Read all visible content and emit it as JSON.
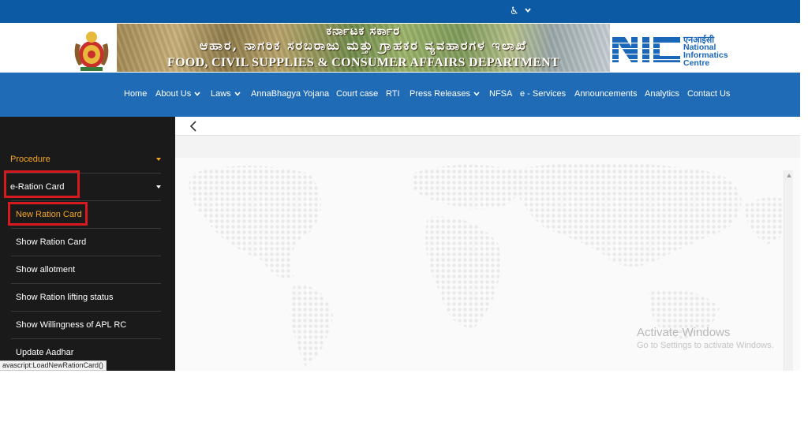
{
  "topbar": {
    "accessibility_symbol": "♿"
  },
  "banner": {
    "kannada_title": "ಕರ್ನಾಟಕ ಸರ್ಕಾರ",
    "kannada_department": "ಆಹಾರ, ನಾಗರಿಕ ಸರಬರಾಜು ಮತ್ತು ಗ್ರಾಹಕರ ವ್ಯವಹಾರಗಳ ಇಲಾಖೆ",
    "english_department": "FOOD, CIVIL SUPPLIES & CONSUMER AFFAIRS DEPARTMENT",
    "nic_hindi": "एनआईसी",
    "nic_line1": "National",
    "nic_line2": "Informatics",
    "nic_line3": "Centre"
  },
  "nav": {
    "items": [
      {
        "label": "Home",
        "dropdown": false
      },
      {
        "label": "About Us",
        "dropdown": true
      },
      {
        "label": "Laws",
        "dropdown": true
      },
      {
        "label": "AnnaBhagya Yojana",
        "dropdown": false
      },
      {
        "label": "Court case",
        "dropdown": false
      },
      {
        "label": "RTI",
        "dropdown": false
      },
      {
        "label": "Press Releases",
        "dropdown": true
      },
      {
        "label": "NFSA",
        "dropdown": false
      },
      {
        "label": "e - Services",
        "dropdown": false
      },
      {
        "label": "Announcements",
        "dropdown": false
      },
      {
        "label": "Analytics",
        "dropdown": false
      },
      {
        "label": "Contact Us",
        "dropdown": false
      }
    ]
  },
  "sidebar": {
    "items": [
      {
        "label": "Procedure",
        "color": "#f5a623"
      },
      {
        "label": "e-Ration Card",
        "color": "#ffffff"
      },
      {
        "label": "New Ration Card",
        "color": "#f5a623"
      },
      {
        "label": "Show Ration Card",
        "color": "#ffffff"
      },
      {
        "label": "Show allotment",
        "color": "#ffffff"
      },
      {
        "label": "Show Ration lifting status",
        "color": "#ffffff"
      },
      {
        "label": "Show Willingness of APL RC",
        "color": "#ffffff"
      },
      {
        "label": "Update Aadhar",
        "color": "#ffffff"
      }
    ]
  },
  "watermark": {
    "line1": "Activate Windows",
    "line2": "Go to Settings to activate Windows."
  },
  "statusbar": {
    "text": "avascript:LoadNewRationCard()"
  },
  "colors": {
    "topbar": "#0b5aa3",
    "navbar": "#1f6bb5",
    "sidebar": "#1a1a1a",
    "accent": "#f5a623",
    "highlight": "#d71920"
  }
}
